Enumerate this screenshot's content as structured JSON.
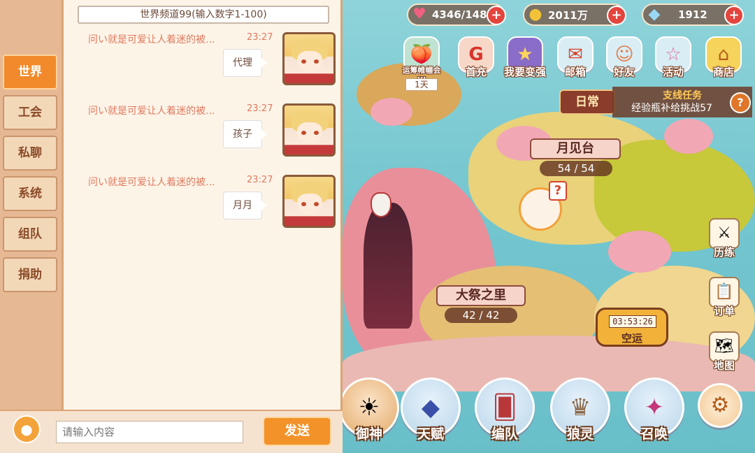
{
  "resources": {
    "stamina": "4346/148",
    "gold": "2011万",
    "crystal": "1912",
    "plus": "+"
  },
  "top_icons": [
    {
      "label": "运筹帷幄会XI",
      "sub": "1天",
      "icon": "event-icon",
      "glyph": "🍑"
    },
    {
      "label": "首充",
      "icon": "first-recharge-icon",
      "glyph": "G"
    },
    {
      "label": "我要变强",
      "icon": "power-up-icon",
      "glyph": "★"
    },
    {
      "label": "邮箱",
      "icon": "mail-icon",
      "glyph": "✉"
    },
    {
      "label": "好友",
      "icon": "friends-icon",
      "glyph": "☺"
    },
    {
      "label": "活动",
      "icon": "activity-icon",
      "glyph": "☆"
    },
    {
      "label": "商店",
      "icon": "shop-icon",
      "glyph": "⌂"
    }
  ],
  "chat": {
    "channel": "世界频道99(输入数字1-100)",
    "tabs": [
      "世界",
      "工会",
      "私聊",
      "系统",
      "组队",
      "捐助"
    ],
    "messages": [
      {
        "sender": "问い就是可爱让人着迷的被...",
        "time": "23:27",
        "text": "代理"
      },
      {
        "sender": "问い就是可爱让人着迷的被...",
        "time": "23:27",
        "text": "孩子"
      },
      {
        "sender": "问い就是可爱让人着迷的被...",
        "time": "23:27",
        "text": "月月"
      }
    ],
    "placeholder": "请输入内容",
    "send": "发送"
  },
  "map": {
    "daily_tag": "日常",
    "quest_title": "支线任务",
    "quest_desc": "经验瓶补给挑战57",
    "help": "?",
    "locations": [
      {
        "name": "月见台",
        "count": "54 / 54"
      },
      {
        "name": "大祭之里",
        "count": "42 / 42"
      }
    ],
    "airship_timer": "03:53:26",
    "airship_label": "空运",
    "side_buttons": [
      {
        "label": "历练",
        "icon": "training-icon",
        "glyph": "⚔"
      },
      {
        "label": "订单",
        "icon": "order-icon",
        "glyph": "📋"
      },
      {
        "label": "地图",
        "icon": "map-icon",
        "glyph": "🗺"
      }
    ]
  },
  "bottom_menu": [
    {
      "label": "御神",
      "icon": "god-icon",
      "glyph": "☀"
    },
    {
      "label": "天赋",
      "icon": "talent-icon",
      "glyph": "◆"
    },
    {
      "label": "编队",
      "icon": "team-icon",
      "glyph": "🂠"
    },
    {
      "label": "狼灵",
      "icon": "wolf-spirit-icon",
      "glyph": "♛"
    },
    {
      "label": "召唤",
      "icon": "summon-icon",
      "glyph": "✦"
    },
    {
      "label": "",
      "icon": "settings-icon",
      "glyph": "⚙"
    }
  ]
}
